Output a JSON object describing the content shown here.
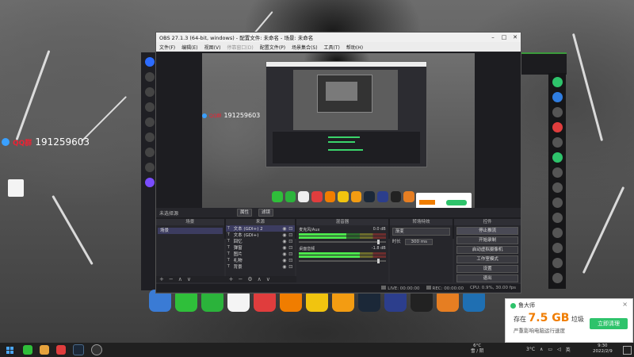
{
  "desktop": {
    "qq_tag": "QQ群",
    "qq_number": "191259603"
  },
  "obs": {
    "title": "OBS 27.1.3 (64-bit, windows) - 配置文件: 未命名 - 场景: 未命名",
    "menu": [
      "文件(F)",
      "编辑(E)",
      "视图(V)",
      "停靠窗口(D)",
      "配置文件(P)",
      "场景集合(S)",
      "工具(T)",
      "帮助(H)"
    ],
    "preview": {
      "qq_tag": "QQ群",
      "qq_number": "191259603"
    },
    "context": {
      "no_source": "未选择源",
      "properties": "属性",
      "filters": "滤镜"
    },
    "docks": {
      "scenes": {
        "title": "场景",
        "items": [
          "场景"
        ]
      },
      "sources": {
        "title": "来源",
        "items": [
          {
            "icon": "T",
            "name": "文本 (GDI+) 2"
          },
          {
            "icon": "T",
            "name": "文本 (GDI+)"
          },
          {
            "icon": "T",
            "name": "回忆"
          },
          {
            "icon": "T",
            "name": "弹窗"
          },
          {
            "icon": "T",
            "name": "图片"
          },
          {
            "icon": "T",
            "name": "礼物"
          },
          {
            "icon": "T",
            "name": "背景"
          }
        ]
      },
      "mixer": {
        "title": "混音器",
        "channels": [
          {
            "name": "麦克风/Aux",
            "db": "0.0 dB",
            "level": 0.55
          },
          {
            "name": "桌面音频",
            "db": "-1.8 dB",
            "level": 0.7
          }
        ]
      },
      "transitions": {
        "title": "转场特效",
        "type": "渐变",
        "duration_label": "时长",
        "duration_value": "300 ms"
      },
      "controls": {
        "title": "控件",
        "buttons": [
          "停止推流",
          "开始录制",
          "启动虚拟摄像机",
          "工作室模式",
          "设置",
          "退出"
        ]
      }
    },
    "status": {
      "live": "LIVE: 00:00:00",
      "rec": "REC: 00:00:00",
      "cpu": "CPU: 0.9%, 30.00 fps"
    }
  },
  "notification": {
    "app": "鲁大师",
    "prefix": "存在",
    "size": "7.5 GB",
    "suffix": "垃圾",
    "subtitle": "严重影响电脑运行速度",
    "button": "立即清理",
    "close": "×"
  },
  "taskbar": {
    "weather_temp": "6°C",
    "weather_desc": "雪 / 阴",
    "tray_temp": "3°C",
    "tray_lang": "英",
    "time": "9:30",
    "date": "2022/2/9"
  },
  "colors": {
    "accent_green": "#2ec36b",
    "warning_orange": "#f07d00",
    "qq_red": "#e23333",
    "obs_bg": "#2b2b30"
  }
}
